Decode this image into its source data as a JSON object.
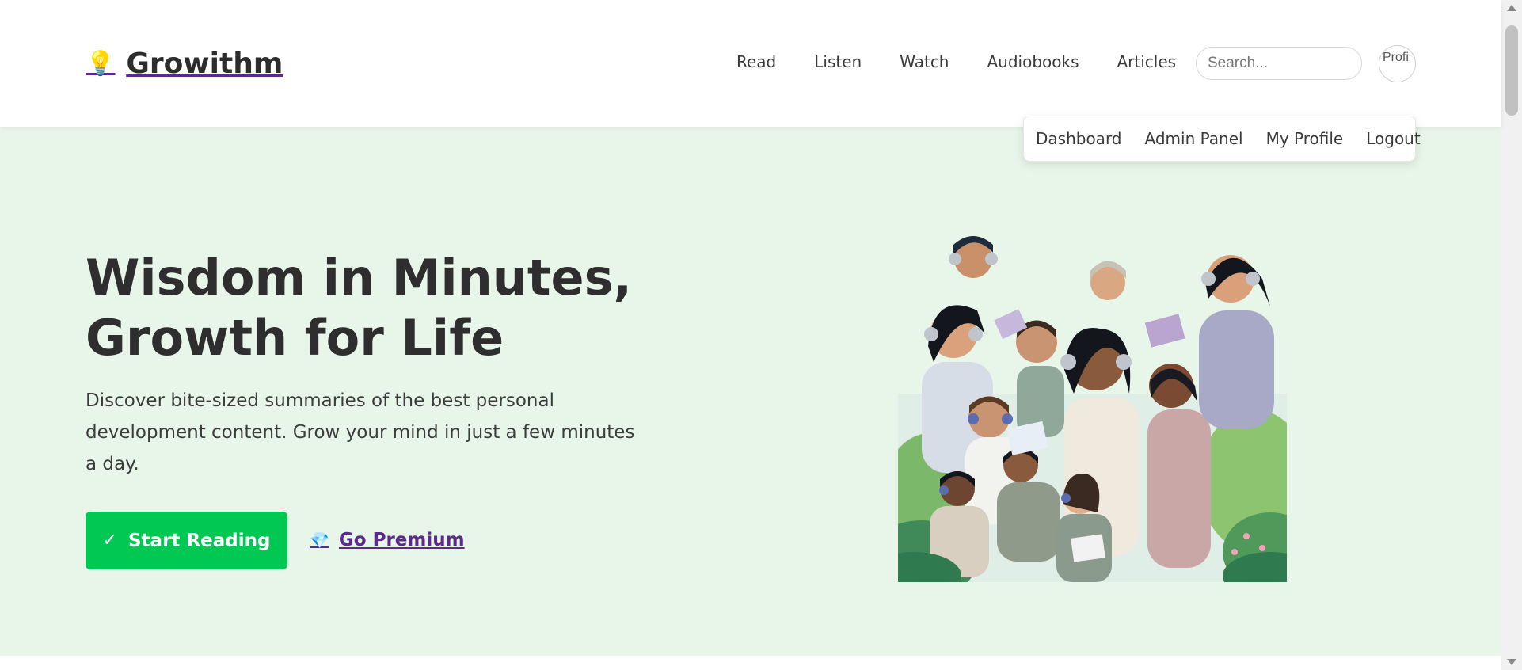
{
  "brand": {
    "icon": "lightbulb-icon",
    "name": "Growithm"
  },
  "nav": {
    "items": [
      "Read",
      "Listen",
      "Watch",
      "Audiobooks",
      "Articles"
    ]
  },
  "search": {
    "placeholder": "Search..."
  },
  "avatar": {
    "alt_text": "Profi"
  },
  "user_menu": {
    "items": [
      "Dashboard",
      "Admin Panel",
      "My Profile",
      "Logout"
    ]
  },
  "hero": {
    "title_line1": "Wisdom in Minutes,",
    "title_line2": "Growth for Life",
    "subtitle": "Discover bite-sized summaries of the best personal development content. Grow your mind in just a few minutes a day.",
    "primary_button": "Start Reading",
    "primary_button_icon": "check-icon",
    "secondary_link": "Go Premium",
    "secondary_link_icon": "gem-icon"
  },
  "colors": {
    "hero_background": "#e8f5e9",
    "primary_button": "#00c853",
    "link": "#5b2a8a"
  }
}
